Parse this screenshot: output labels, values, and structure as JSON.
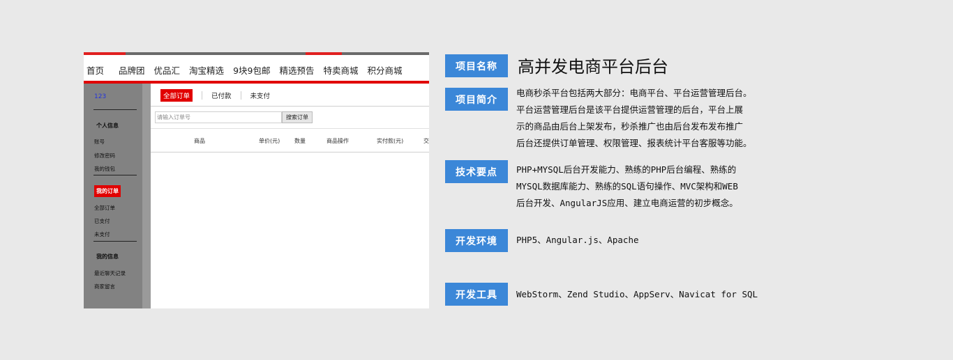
{
  "screenshot": {
    "nav": [
      "首页",
      "品牌团",
      "优品汇",
      "淘宝精选",
      "9块9包邮",
      "精选预告",
      "特卖商城",
      "积分商城"
    ],
    "sidebar": {
      "user": "123",
      "section1_title": "个人信息",
      "section1_items": [
        "账号",
        "修改密码",
        "我的钱包"
      ],
      "active_section": "我的订单",
      "section2_items": [
        "全部订单",
        "已支付",
        "未支付"
      ],
      "section3_title": "我的信息",
      "section3_items": [
        "最近聊天记录",
        "商家留言"
      ]
    },
    "tabs": [
      "全部订单",
      "已付款",
      "未支付"
    ],
    "search": {
      "placeholder": "请输入订单号",
      "button": "搜索订单"
    },
    "table_headers": [
      "商品",
      "单价(元)",
      "数量",
      "商品操作",
      "实付款(元)",
      "交"
    ]
  },
  "info": {
    "name_label": "项目名称",
    "name_value": "高并发电商平台后台",
    "intro_label": "项目简介",
    "intro_lines": [
      "电商秒杀平台包括两大部分：电商平台、平台运营管理后台。",
      "平台运营管理后台是该平台提供运营管理的后台，平台上展",
      "示的商品由后台上架发布，秒杀推广也由后台发布发布推广",
      "后台还提供订单管理、权限管理、报表统计平台客服等功能。"
    ],
    "tech_label": "技术要点",
    "tech_lines": [
      "PHP+MYSQL后台开发能力、熟练的PHP后台编程、熟练的",
      "MYSQL数据库能力、熟练的SQL语句操作、MVC架构和WEB",
      "后台开发、AngularJS应用、建立电商运营的初步概念。"
    ],
    "env_label": "开发环境",
    "env_value": "PHP5、Angular.js、Apache",
    "tools_label": "开发工具",
    "tools_value": "WebStorm、Zend Studio、AppServ、Navicat for SQL"
  },
  "colors": {
    "accent_blue": "#3b87d8",
    "brand_red": "#e10000",
    "background": "#e9e9e9"
  }
}
